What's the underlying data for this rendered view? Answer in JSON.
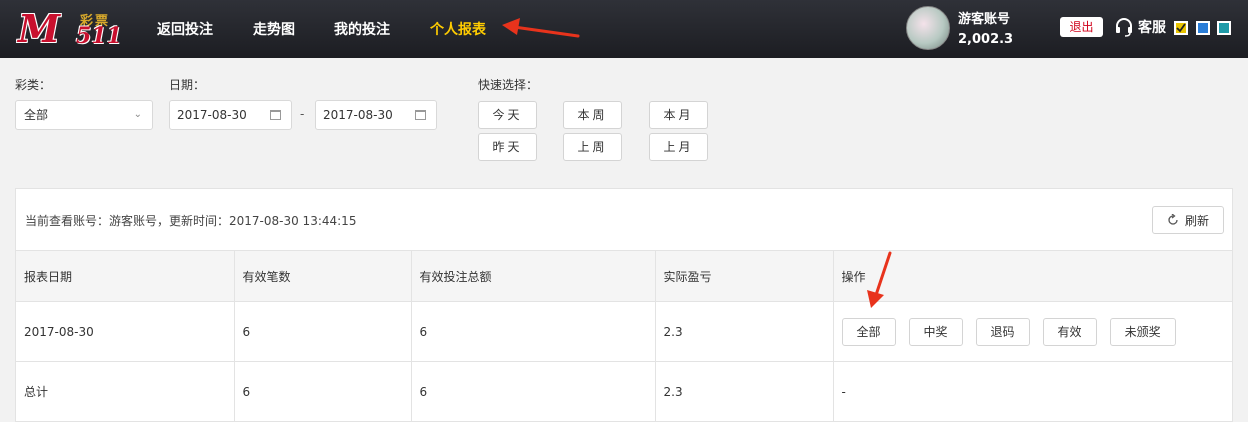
{
  "header": {
    "logo": {
      "big": "M",
      "lottery": "彩票",
      "num": "511"
    },
    "nav": [
      "返回投注",
      "走势图",
      "我的投注",
      "个人报表"
    ],
    "user": {
      "name": "游客账号",
      "balance": "2,002.3"
    },
    "logout_label": "退出",
    "service_label": "客服",
    "theme_colors": [
      "#e8c400",
      "#2a7ed8",
      "#1f9aa8"
    ]
  },
  "filters": {
    "type_label": "彩类：",
    "type_value": "全部",
    "date_label": "日期：",
    "date_from": "2017-08-30",
    "date_sep": "-",
    "date_to": "2017-08-30",
    "quick_label": "快速选择：",
    "quick": [
      "今天",
      "本周",
      "本月",
      "昨天",
      "上周",
      "上月"
    ]
  },
  "panel": {
    "info": "当前查看账号：游客账号，更新时间：2017-08-30 13:44:15",
    "refresh_label": "刷新",
    "columns": [
      "报表日期",
      "有效笔数",
      "有效投注总额",
      "实际盈亏",
      "操作"
    ],
    "rows": [
      {
        "date": "2017-08-30",
        "count": "6",
        "total": "6",
        "profit": "2.3"
      }
    ],
    "summary": {
      "label": "总计",
      "count": "6",
      "total": "6",
      "profit": "2.3",
      "ops": "-"
    },
    "actions": [
      "全部",
      "中奖",
      "退码",
      "有效",
      "未颁奖"
    ]
  },
  "colors": {
    "accent": "#ffcc00",
    "profit": "#e02d2d",
    "arrow": "#e8331c"
  }
}
